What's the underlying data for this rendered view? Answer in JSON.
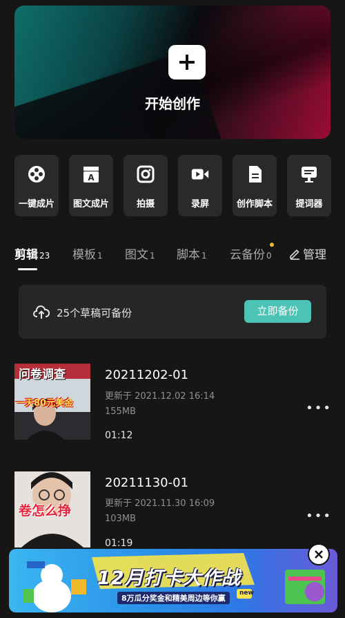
{
  "hero": {
    "title": "开始创作",
    "icon": "plus-icon"
  },
  "tools": [
    {
      "label": "一键成片",
      "icon": "film-reel-icon"
    },
    {
      "label": "图文成片",
      "icon": "text-clapper-icon"
    },
    {
      "label": "拍摄",
      "icon": "camera-icon"
    },
    {
      "label": "录屏",
      "icon": "video-record-icon"
    },
    {
      "label": "创作脚本",
      "icon": "document-icon"
    },
    {
      "label": "提词器",
      "icon": "teleprompter-icon"
    }
  ],
  "tabs": [
    {
      "label": "剪辑",
      "count": "23",
      "active": true
    },
    {
      "label": "模板",
      "count": "1"
    },
    {
      "label": "图文",
      "count": "1"
    },
    {
      "label": "脚本",
      "count": "1"
    },
    {
      "label": "云备份",
      "count": "0"
    }
  ],
  "manage": {
    "label": "管理"
  },
  "backup": {
    "text": "25个草稿可备份",
    "button": "立即备份"
  },
  "drafts": [
    {
      "name": "20211202-01",
      "updated": "更新于 2021.12.02 16:14",
      "size": "155MB",
      "duration": "01:12",
      "thumb_top_text": "问卷调查",
      "thumb_mid_text": "一天80元美金"
    },
    {
      "name": "20211130-01",
      "updated": "更新于 2021.11.30 16:09",
      "size": "103MB",
      "duration": "01:19",
      "thumb_mid_text": "卷怎么挣"
    }
  ],
  "banner": {
    "title": "12月打卡大作战",
    "subtitle": "8万瓜分奖金和精美周边等你赢",
    "badge": "new"
  },
  "colors": {
    "accent": "#4cc3b5",
    "dot": "#f2b92d",
    "bg": "#161616"
  }
}
